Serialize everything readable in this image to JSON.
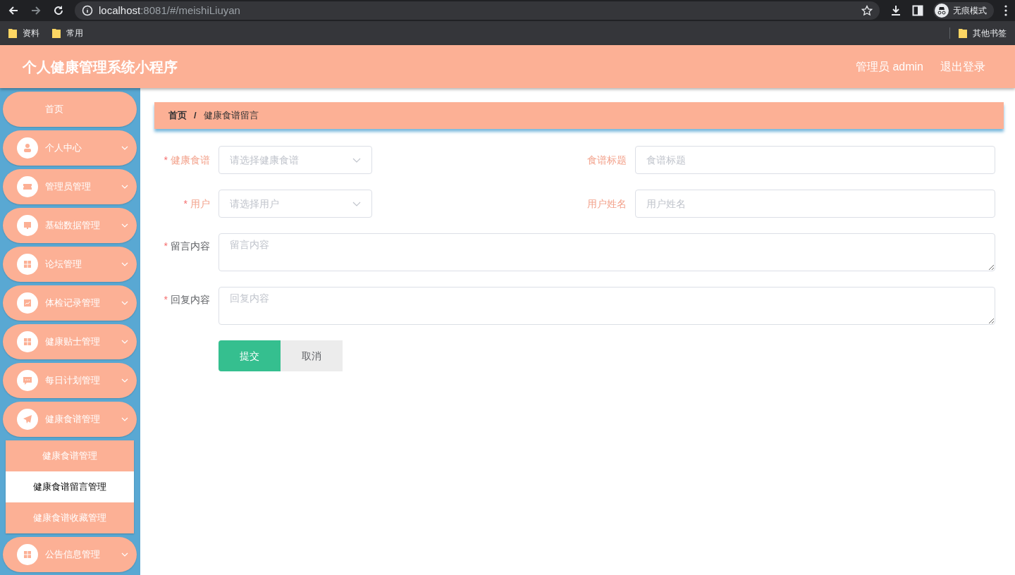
{
  "browser": {
    "url_host": "localhost",
    "url_rest": ":8081/#/meishiLiuyan",
    "profile": "无痕模式",
    "bookmarks": [
      "资料",
      "常用"
    ],
    "other_bookmarks": "其他书签"
  },
  "header": {
    "title": "个人健康管理系统小程序",
    "user": "管理员 admin",
    "logout": "退出登录"
  },
  "sidebar": {
    "items": [
      {
        "label": "首页",
        "has_icon": false
      },
      {
        "label": "个人中心",
        "has_icon": true
      },
      {
        "label": "管理员管理",
        "has_icon": true
      },
      {
        "label": "基础数据管理",
        "has_icon": true
      },
      {
        "label": "论坛管理",
        "has_icon": true
      },
      {
        "label": "体检记录管理",
        "has_icon": true
      },
      {
        "label": "健康贴士管理",
        "has_icon": true
      },
      {
        "label": "每日计划管理",
        "has_icon": true
      },
      {
        "label": "健康食谱管理",
        "has_icon": true,
        "children": [
          {
            "label": "健康食谱管理",
            "selected": false
          },
          {
            "label": "健康食谱留言管理",
            "selected": true
          },
          {
            "label": "健康食谱收藏管理",
            "selected": false
          }
        ]
      },
      {
        "label": "公告信息管理",
        "has_icon": true
      }
    ]
  },
  "breadcrumb": [
    "首页",
    "健康食谱留言"
  ],
  "breadcrumb_separator": "/",
  "required_mark": "*",
  "form": {
    "rows": [
      [
        {
          "kind": "select",
          "label": "健康食谱",
          "required": true,
          "disabled": true,
          "placeholder": "请选择健康食谱"
        },
        {
          "kind": "input",
          "label": "食谱标题",
          "required": false,
          "disabled": true,
          "placeholder": "食谱标题"
        }
      ],
      [
        {
          "kind": "select",
          "label": "用户",
          "required": true,
          "disabled": true,
          "placeholder": "请选择用户"
        },
        {
          "kind": "input",
          "label": "用户姓名",
          "required": false,
          "disabled": true,
          "placeholder": "用户姓名"
        }
      ],
      [
        {
          "kind": "textarea",
          "label": "留言内容",
          "required": true,
          "disabled": false,
          "placeholder": "留言内容"
        }
      ],
      [
        {
          "kind": "textarea",
          "label": "回复内容",
          "required": true,
          "disabled": false,
          "placeholder": "回复内容"
        }
      ]
    ],
    "buttons": [
      {
        "kind": "primary",
        "label": "提交"
      },
      {
        "kind": "secondary",
        "label": "取消"
      }
    ]
  }
}
